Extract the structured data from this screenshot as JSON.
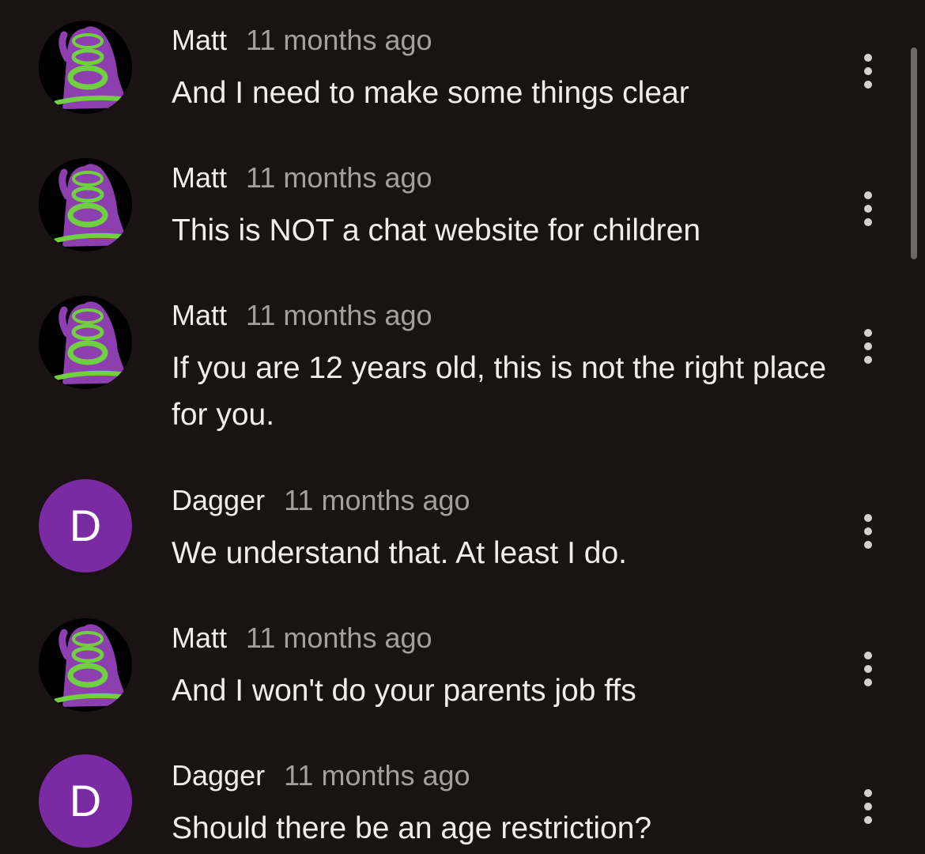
{
  "comments": [
    {
      "author": "Matt",
      "time": "11 months ago",
      "text": "And I need to make some things clear",
      "avatar_type": "image",
      "avatar_letter": ""
    },
    {
      "author": "Matt",
      "time": "11 months ago",
      "text": "This is NOT a chat website for children",
      "avatar_type": "image",
      "avatar_letter": ""
    },
    {
      "author": "Matt",
      "time": "11 months ago",
      "text": "If you are 12 years old, this is not the right place for you.",
      "avatar_type": "image",
      "avatar_letter": ""
    },
    {
      "author": "Dagger",
      "time": "11 months ago",
      "text": "We understand that. At least I do.",
      "avatar_type": "letter",
      "avatar_letter": "D"
    },
    {
      "author": "Matt",
      "time": "11 months ago",
      "text": "And I won't do your parents job ffs",
      "avatar_type": "image",
      "avatar_letter": ""
    },
    {
      "author": "Dagger",
      "time": "11 months ago",
      "text": "Should there be an age restriction?",
      "avatar_type": "letter",
      "avatar_letter": "D"
    }
  ],
  "icons": {
    "more": "more-vertical-icon",
    "avatar_image": "purple-tentacle-avatar"
  },
  "colors": {
    "background": "#1b1313",
    "text": "#f3ecec",
    "timestamp": "#a79f9f",
    "letter_avatar": "#7a2aa3",
    "tentacle_purple": "#8d3fb0",
    "tentacle_green": "#6fd13f"
  }
}
